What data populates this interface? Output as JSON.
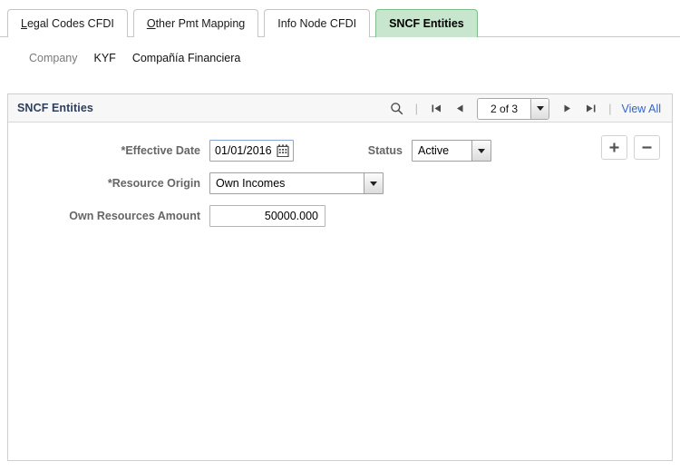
{
  "tabs": [
    {
      "label": "Legal Codes CFDI",
      "accel": "L",
      "active": false
    },
    {
      "label": "Other Pmt Mapping",
      "accel": "O",
      "active": false
    },
    {
      "label": "Info Node CFDI",
      "accel": "",
      "active": false
    },
    {
      "label": "SNCF Entities",
      "accel": "",
      "active": true
    }
  ],
  "header": {
    "company_label": "Company",
    "company_code": "KYF",
    "company_name": "Compañía Financiera"
  },
  "panel": {
    "title": "SNCF Entities",
    "nav": {
      "search_icon": "search-icon",
      "first_icon": "first-page-icon",
      "prev_icon": "previous-page-icon",
      "next_icon": "next-page-icon",
      "last_icon": "last-page-icon",
      "page_indicator": "2 of 3",
      "page_dropdown_icon": "chevron-down-icon",
      "separator": "|",
      "view_all_label": "View All"
    },
    "form": {
      "effective_date_label": "*Effective Date",
      "effective_date_value": "01/01/2016",
      "calendar_icon": "calendar-icon",
      "status_label": "Status",
      "status_value": "Active",
      "resource_origin_label": "*Resource Origin",
      "resource_origin_value": "Own Incomes",
      "own_resources_label": "Own Resources Amount",
      "own_resources_value": "50000.000",
      "add_row_label": "+",
      "delete_row_label": "−"
    }
  },
  "colors": {
    "active_tab_bg": "#c8e6cd",
    "active_tab_border": "#7fbd8c",
    "link": "#3366cc",
    "panel_title": "#2e3f5c",
    "label_gray": "#666666"
  }
}
